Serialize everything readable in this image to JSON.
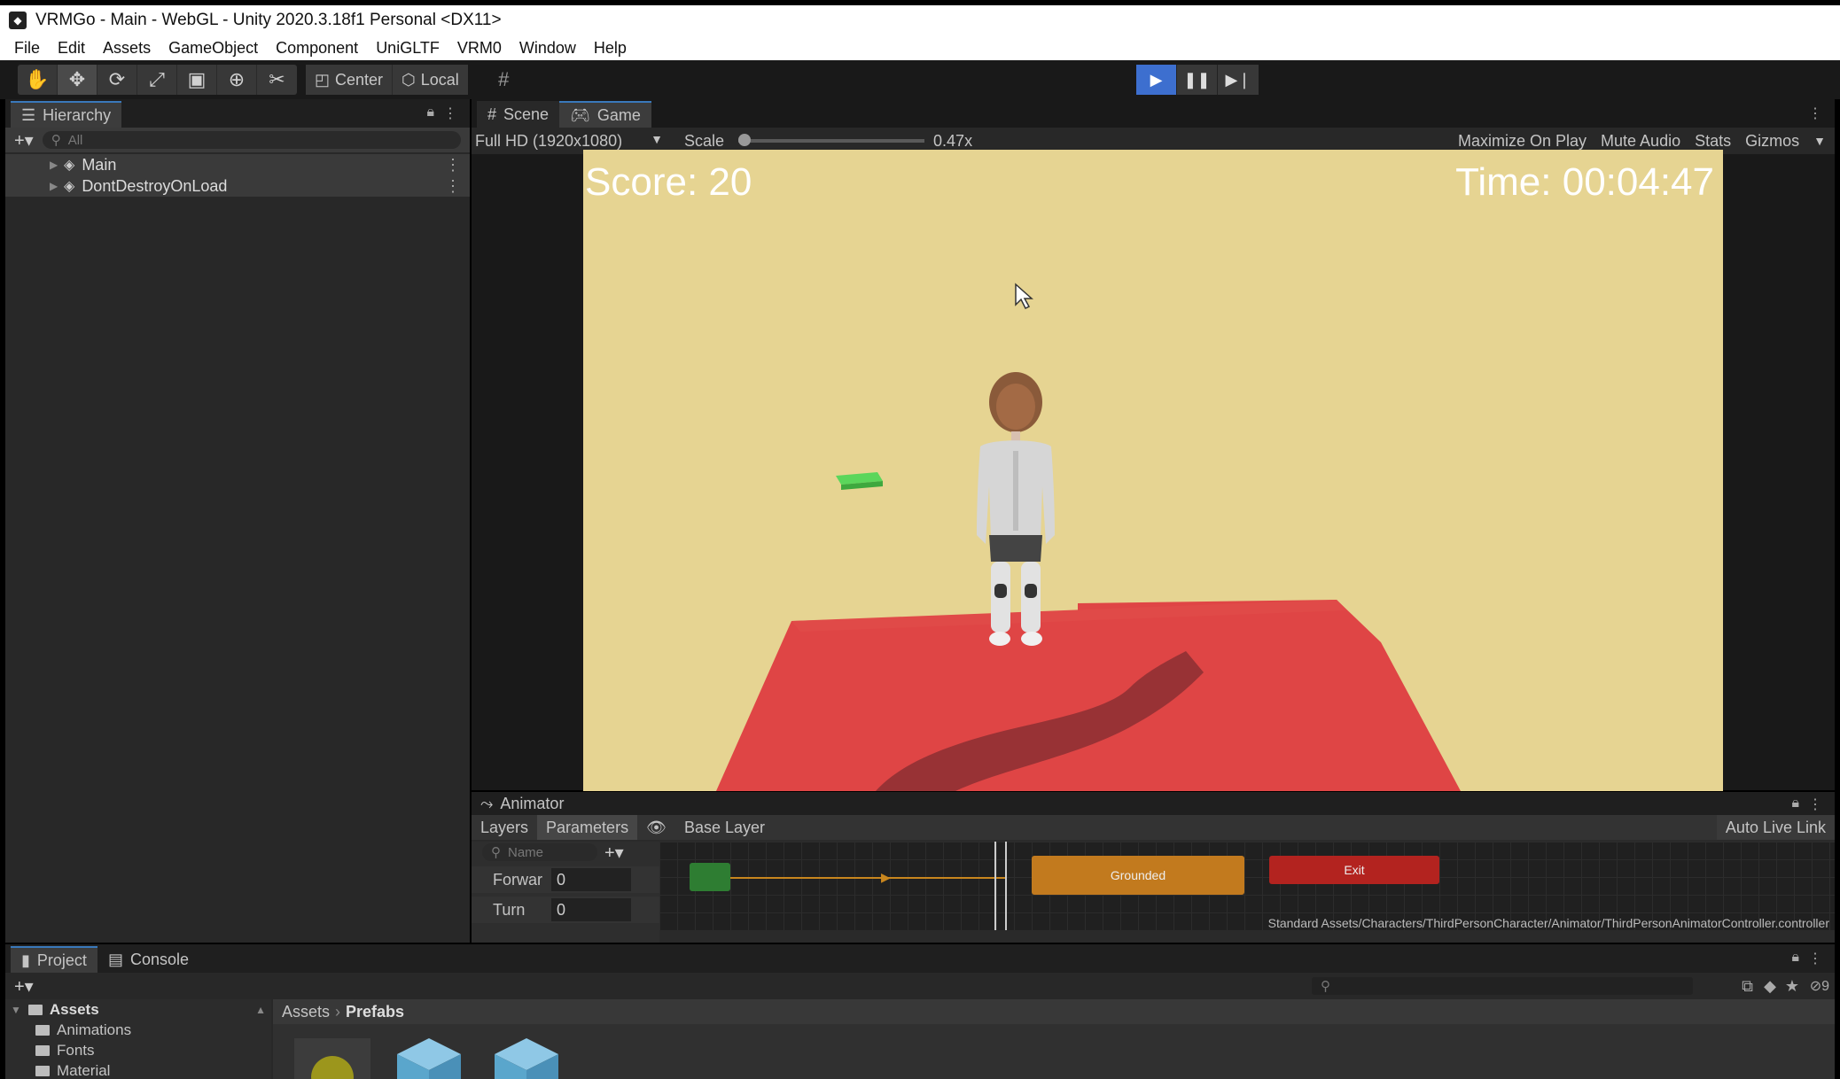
{
  "window": {
    "title": "VRMGo - Main - WebGL - Unity 2020.3.18f1 Personal <DX11>"
  },
  "menu": [
    "File",
    "Edit",
    "Assets",
    "GameObject",
    "Component",
    "UniGLTF",
    "VRM0",
    "Window",
    "Help"
  ],
  "toolbar": {
    "tools": [
      "hand-tool-icon",
      "move-tool-icon",
      "rotate-tool-icon",
      "scale-tool-icon",
      "rect-tool-icon",
      "transform-tool-icon",
      "custom-tool-icon"
    ],
    "pivot_label": "Center",
    "space_label": "Local",
    "play_state": "playing"
  },
  "hierarchy": {
    "tab_label": "Hierarchy",
    "search_placeholder": "All",
    "items": [
      {
        "label": "Main"
      },
      {
        "label": "DontDestroyOnLoad"
      }
    ]
  },
  "game_view": {
    "tabs": [
      {
        "label": "Scene"
      },
      {
        "label": "Game"
      }
    ],
    "resolution": "Full HD (1920x1080)",
    "scale_label": "Scale",
    "scale_value": "0.47x",
    "buttons": {
      "maximize": "Maximize On Play",
      "mute": "Mute Audio",
      "stats": "Stats",
      "gizmos": "Gizmos"
    },
    "hud": {
      "score": "Score: 20",
      "time": "Time: 00:04:47"
    },
    "colors": {
      "sky": "#e6d492",
      "floor": "#de4545",
      "pickup": "#5bd65b"
    }
  },
  "animator": {
    "tab_label": "Animator",
    "subtabs": {
      "layers": "Layers",
      "parameters": "Parameters"
    },
    "layer_name": "Base Layer",
    "auto_live_link": "Auto Live Link",
    "search_placeholder": "Name",
    "params": [
      {
        "name": "Forwar",
        "value": "0"
      },
      {
        "name": "Turn",
        "value": "0"
      }
    ],
    "nodes": {
      "grounded": "Grounded",
      "exit": "Exit"
    },
    "controller_path": "Standard Assets/Characters/ThirdPersonCharacter/Animator/ThirdPersonAnimatorController.controller"
  },
  "project": {
    "tabs": {
      "project": "Project",
      "console": "Console"
    },
    "tree": {
      "root": "Assets",
      "children": [
        "Animations",
        "Fonts",
        "Material"
      ]
    },
    "breadcrumb": {
      "root": "Assets",
      "current": "Prefabs"
    },
    "hidden_count": "9"
  }
}
